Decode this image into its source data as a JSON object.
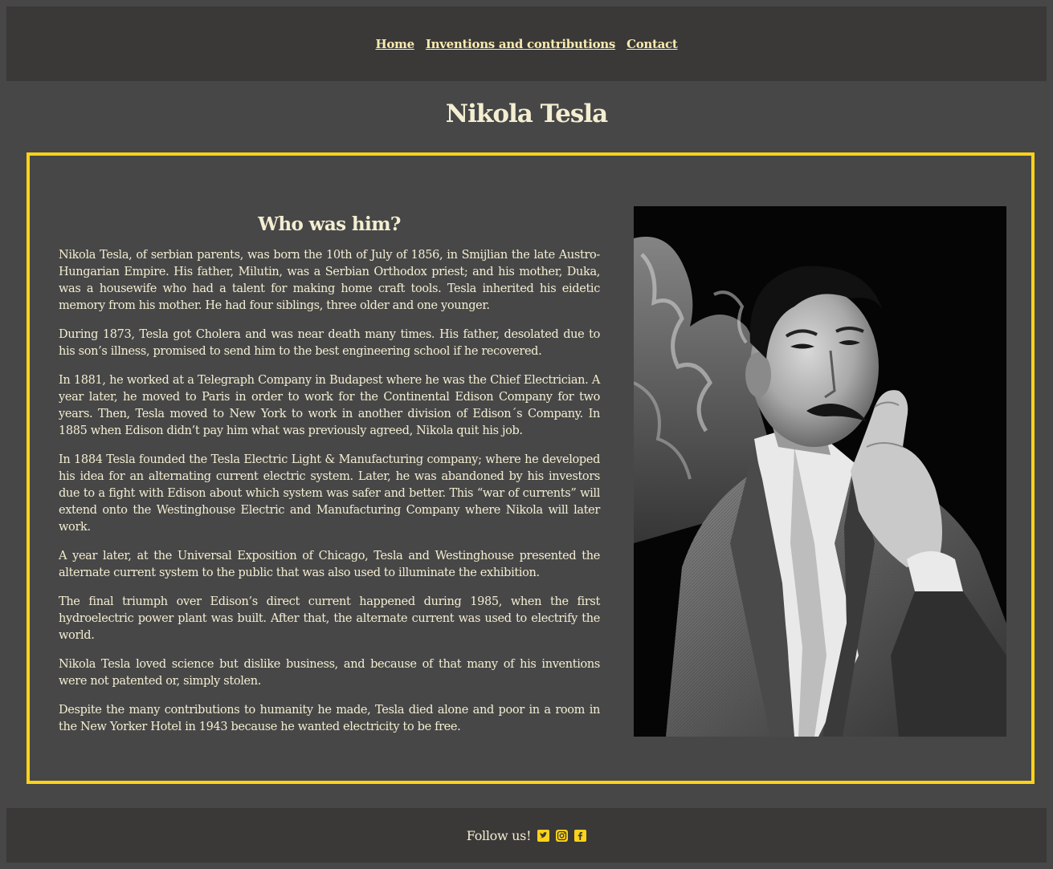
{
  "nav": {
    "items": [
      {
        "label": "Home"
      },
      {
        "label": "Inventions and contributions"
      },
      {
        "label": "Contact"
      }
    ]
  },
  "page": {
    "title": "Nikola Tesla"
  },
  "bio": {
    "title": "Who was him?",
    "paragraphs": [
      "Nikola Tesla, of serbian parents, was born the 10th of July of 1856, in Smijlian the late Austro-Hungarian Empire. His father, Milutin, was a Serbian Orthodox priest; and his mother, Duka, was a housewife who had a talent for making home craft tools. Tesla inherited his eidetic memory from his mother. He had four siblings, three older and one younger.",
      "During 1873, Tesla got Cholera and was near death many times. His father, desolated due to his son’s illness, promised to send him to the best engineering school if he recovered.",
      "In 1881, he worked at a Telegraph Company in Budapest where he was the Chief Electrician. A year later, he moved to Paris in order to work for the Continental Edison Company for two years. Then, Tesla moved to New York to work in another division of Edison´s Company. In 1885 when Edison didn’t pay him what was previously agreed, Nikola quit his job.",
      "In 1884 Tesla founded the Tesla Electric Light & Manufacturing company; where he developed his idea for an alternating current electric system. Later, he was abandoned by his investors due to a fight with Edison about which system was safer and better. This “war of currents” will extend onto the Westinghouse Electric and Manufacturing Company where Nikola will later work.",
      "A year later, at the Universal Exposition of Chicago, Tesla and Westinghouse presented the alternate current system to the public that was also used to illuminate the exhibition.",
      "The final triumph over Edison’s direct current happened during 1985, when the first hydroelectric power plant was built. After that, the alternate current was used to electrify the world.",
      "Nikola Tesla loved science but dislike business, and because of that many of his inventions were not patented or, simply stolen.",
      "Despite the many contributions to humanity he made, Tesla died alone and poor in a room in the New Yorker Hotel in 1943 because he wanted electricity to be free."
    ]
  },
  "footer": {
    "label": "Follow us!",
    "icons": [
      "twitter-icon",
      "instagram-icon",
      "facebook-icon"
    ]
  },
  "colors": {
    "accent": "#fdd319",
    "background": "#474747",
    "bar": "#3a3937",
    "text": "#f4eed2",
    "link": "#fbeab0"
  }
}
